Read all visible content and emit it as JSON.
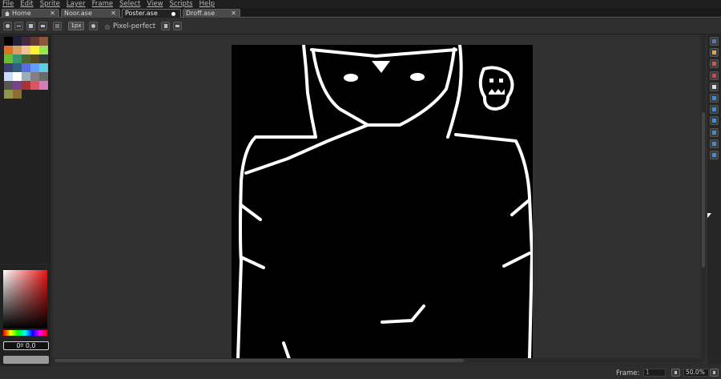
{
  "menu": [
    "File",
    "Edit",
    "Sprite",
    "Layer",
    "Frame",
    "Select",
    "View",
    "Scripts",
    "Help"
  ],
  "tabs": [
    {
      "label": "Home",
      "close": "✕"
    },
    {
      "label": "Noor.ase",
      "close": "✕"
    },
    {
      "label": "Poster.ase",
      "close": ""
    },
    {
      "label": "Droff.ase",
      "close": "✕"
    }
  ],
  "context": {
    "brush_size": "1px",
    "pixel_perfect_label": "Pixel-perfect"
  },
  "palette": {
    "colors": [
      "#000000",
      "#222034",
      "#45283c",
      "#663931",
      "#8f563b",
      "#df7126",
      "#d9a066",
      "#eec39a",
      "#fbf236",
      "#99e550",
      "#6abe30",
      "#37946e",
      "#4b692f",
      "#524b24",
      "#323c39",
      "#3f3f74",
      "#306082",
      "#5b6ee1",
      "#639bff",
      "#5fcde4",
      "#cbdbfc",
      "#ffffff",
      "#9badb7",
      "#847e87",
      "#696a6a",
      "#595652",
      "#76428a",
      "#ac3232",
      "#d95763",
      "#d77bba",
      "#8f974a",
      "#8a6f30"
    ]
  },
  "color_picker": {
    "hue_color": "#e81414",
    "current_value": "0º 0,0"
  },
  "canvas": {
    "background": "#000000",
    "stroke_color": "#ffffff"
  },
  "tools": [
    {
      "icon": "rectangle-marquee-icon",
      "color": "#3a7bd5"
    },
    {
      "icon": "pencil-icon",
      "color": "#e8a33b"
    },
    {
      "icon": "eraser-icon",
      "color": "#e05050"
    },
    {
      "icon": "eyedropper-icon",
      "color": "#d04848"
    },
    {
      "icon": "zoom-icon",
      "color": "#e0e0e0"
    },
    {
      "icon": "move-icon",
      "color": "#3a8de0"
    },
    {
      "icon": "paint-bucket-icon",
      "color": "#3a8de0"
    },
    {
      "icon": "line-icon",
      "color": "#3a8de0"
    },
    {
      "icon": "rectangle-icon",
      "color": "#3a8de0"
    },
    {
      "icon": "blur-icon",
      "color": "#3a8de0"
    },
    {
      "icon": "spray-icon",
      "color": "#3a8de0"
    }
  ],
  "status": {
    "frame_label": "Frame:",
    "frame_value": "1",
    "zoom_value": "50.0%"
  }
}
